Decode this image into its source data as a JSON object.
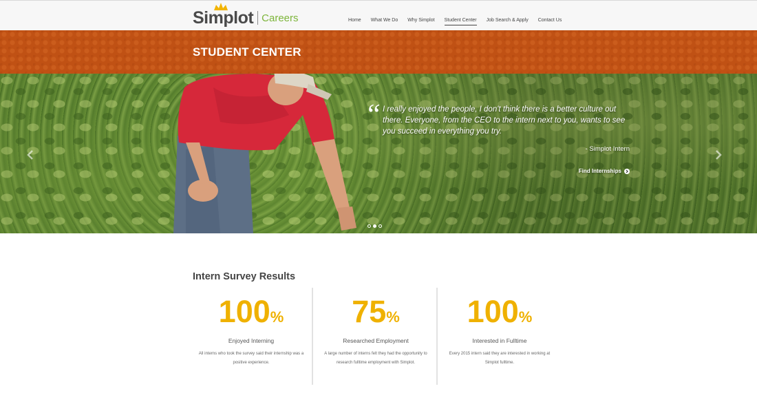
{
  "brand": {
    "name": "Simplot",
    "sub": "Careers"
  },
  "nav": {
    "items": [
      {
        "label": "Home"
      },
      {
        "label": "What We Do"
      },
      {
        "label": "Why Simplot"
      },
      {
        "label": "Student Center",
        "active": true
      },
      {
        "label": "Job Search & Apply"
      },
      {
        "label": "Contact Us"
      }
    ]
  },
  "band": {
    "title": "STUDENT CENTER"
  },
  "hero": {
    "quote_mark": "“",
    "quote": "I really enjoyed the people, I don't think there is a better culture out there. Everyone, from the CEO to the intern next to you, wants to see you succeed in everything you try.",
    "attribution": "- Simplot Intern",
    "link": "Find Internships",
    "prev_icon": "chevron-left-icon",
    "next_icon": "chevron-right-icon",
    "slides": 3,
    "active_slide": 2
  },
  "survey": {
    "title": "Intern Survey Results",
    "stats": [
      {
        "value": "100",
        "unit": "%",
        "label": "Enjoyed Interning",
        "desc": "All interns who took the survey said their internship was a positive experience."
      },
      {
        "value": "75",
        "unit": "%",
        "label": "Researched Employment",
        "desc": "A large number of interns felt they had the opportunity to research fulltime employment with Simplot."
      },
      {
        "value": "100",
        "unit": "%",
        "label": "Interested in Fulltime",
        "desc": "Every 2015 intern said they are interested in working at Simplot fulltime."
      }
    ]
  },
  "colors": {
    "accent_orange": "#c05114",
    "stat_yellow": "#efb100",
    "brand_green": "#7db53a"
  }
}
